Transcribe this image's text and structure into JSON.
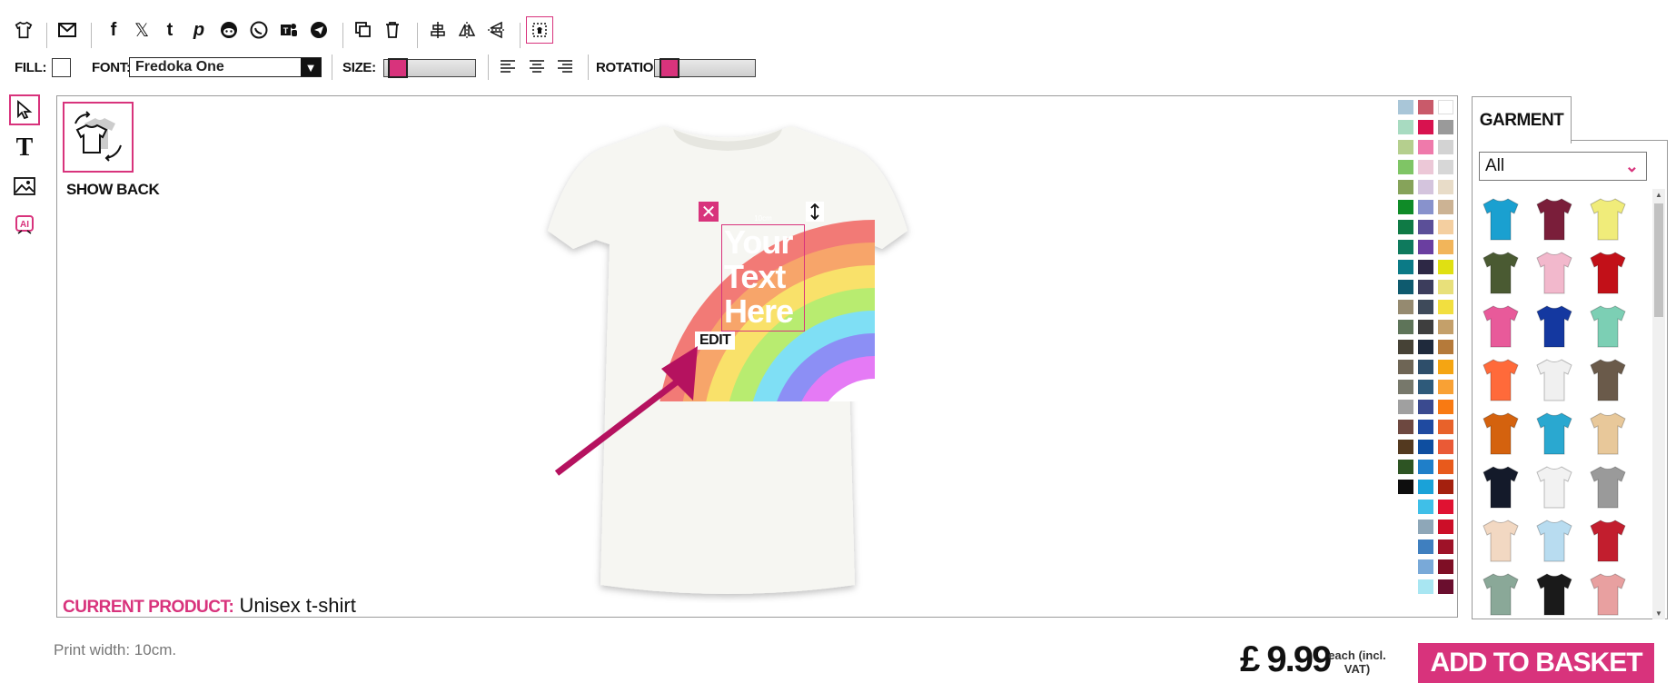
{
  "toolbar": {
    "icons": [
      "tshirt-icon",
      "mail-icon",
      "facebook-icon",
      "x-icon",
      "tumblr-icon",
      "pinterest-icon",
      "reddit-icon",
      "whatsapp-icon",
      "teams-icon",
      "telegram-icon",
      "duplicate-icon",
      "trash-icon",
      "align-center-icon",
      "flip-horizontal-icon",
      "flip-vertical-icon",
      "print-area-icon"
    ]
  },
  "format_bar": {
    "fill_label": "FILL:",
    "font_label": "FONT:",
    "font_value": "Fredoka One",
    "size_label": "SIZE:",
    "rotation_label": "ROTATION:",
    "size_level": 0.05,
    "rotation_level": 0.05
  },
  "left_tools": [
    "pointer-icon",
    "text-icon",
    "image-icon",
    "ai-icon"
  ],
  "canvas": {
    "show_back_label": "SHOW BACK",
    "current_product_label": "CURRENT PRODUCT:",
    "current_product_value": "Unisex t-shirt",
    "design_text": [
      "Your",
      "Text",
      "Here"
    ],
    "measure_label": "10cm",
    "edit_label": "EDIT"
  },
  "swatches": {
    "col1": [
      "#a9c6d8",
      "#a8dbc1",
      "#b5cf8e",
      "#7fc565",
      "#86a35a",
      "#0f8b27",
      "#0f7a45",
      "#0e7a5d",
      "#0b7a86",
      "#0e5a6e",
      "#958a70",
      "#5e7459",
      "#464236",
      "#6e6555",
      "#77786b",
      "#a0a0a0",
      "#6d4840",
      "#53391f",
      "#2d5423",
      "#0e0e0e"
    ],
    "col2": [
      "#c95a6a",
      "#d8124f",
      "#ef7aab",
      "#ecc8d7",
      "#d4c4dd",
      "#8892cc",
      "#5b4f98",
      "#6a3ea0",
      "#2d2845",
      "#3c3d5c",
      "#3e4a5a",
      "#3e3e3e",
      "#1f2a3c",
      "#2e4e6a",
      "#2e5a7a",
      "#3a4a8f",
      "#1f4aa0",
      "#0e4ea0",
      "#1f7fc9",
      "#1aa2d8",
      "#3fbfe8",
      "#8ea7b8",
      "#3f7fbf",
      "#79a9d8",
      "#a8e6f2"
    ],
    "col3": [
      "#ffffff",
      "#9a9a9a",
      "#d3d3d3",
      "#d7d7d7",
      "#e8dcc8",
      "#ccb394",
      "#f4cfa0",
      "#f2b55a",
      "#e0e012",
      "#e8e07a",
      "#f2df3f",
      "#c4a06a",
      "#b57a3a",
      "#f5a512",
      "#f9a134",
      "#f97a12",
      "#e8622a",
      "#ea5a36",
      "#e85a1c",
      "#a4200e",
      "#e01232",
      "#cc0e28",
      "#9e1228",
      "#7e0e25",
      "#6a0e2e"
    ]
  },
  "garment": {
    "tab_label": "GARMENT",
    "filter_value": "All",
    "items": [
      {
        "name": "turquoise-tshirt",
        "color": "#1aa0d0"
      },
      {
        "name": "maroon-tshirt",
        "color": "#7a1e3a"
      },
      {
        "name": "yellow-tshirt",
        "color": "#f0ec7a"
      },
      {
        "name": "olive-tshirt",
        "color": "#4a5a32"
      },
      {
        "name": "pink-tshirt",
        "color": "#f2b8cc"
      },
      {
        "name": "red-tshirt",
        "color": "#c21018"
      },
      {
        "name": "hot-pink-tshirt",
        "color": "#e85a9a"
      },
      {
        "name": "royal-blue-tshirt",
        "color": "#1438a0"
      },
      {
        "name": "mint-tshirt",
        "color": "#7ccfb4"
      },
      {
        "name": "coral-tshirt",
        "color": "#ff6a3a"
      },
      {
        "name": "white-vest",
        "color": "#f0f0f0"
      },
      {
        "name": "brown-vest",
        "color": "#6a5a4a"
      },
      {
        "name": "orange-hoodie",
        "color": "#d4620e"
      },
      {
        "name": "turquoise-hoodie",
        "color": "#2aa8d0"
      },
      {
        "name": "tiedye-tshirt",
        "color": "#e8c89a"
      },
      {
        "name": "navy-tshirt",
        "color": "#141a2a"
      },
      {
        "name": "baseball-tshirt",
        "color": "#f2f2f2"
      },
      {
        "name": "grey-hoodie",
        "color": "#9a9a9a"
      },
      {
        "name": "natural-tshirt",
        "color": "#f2d8c2"
      },
      {
        "name": "lightblue-tshirt",
        "color": "#b8dcf0"
      },
      {
        "name": "varsity-jacket",
        "color": "#c21e2e"
      },
      {
        "name": "sage-longsleeve",
        "color": "#8aa898"
      },
      {
        "name": "black-orange-hoodie",
        "color": "#1a1a1a"
      },
      {
        "name": "peach-vest",
        "color": "#e8a0a0"
      }
    ]
  },
  "footer": {
    "print_width": "Print width: 10cm.",
    "price": "£ 9.99",
    "each_label": "each (incl. VAT)",
    "add_to_basket": "ADD TO BASKET"
  }
}
